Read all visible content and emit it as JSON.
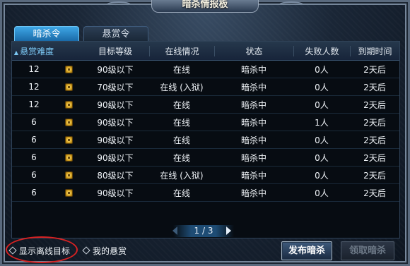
{
  "window": {
    "title": "暗杀情报板"
  },
  "tabs": [
    {
      "label": "暗杀令",
      "active": true
    },
    {
      "label": "悬赏令",
      "active": false
    }
  ],
  "table": {
    "headers": [
      "悬赏难度",
      "目标等级",
      "在线情况",
      "状态",
      "失败人数",
      "到期时间"
    ],
    "sorted_column": "悬赏难度",
    "rows": [
      {
        "difficulty": "12",
        "level": "90级以下",
        "online": "在线",
        "status": "暗杀中",
        "failures": "0人",
        "expire": "2天后"
      },
      {
        "difficulty": "12",
        "level": "70级以下",
        "online": "在线 (入狱)",
        "status": "暗杀中",
        "failures": "0人",
        "expire": "2天后"
      },
      {
        "difficulty": "12",
        "level": "90级以下",
        "online": "在线",
        "status": "暗杀中",
        "failures": "0人",
        "expire": "2天后"
      },
      {
        "difficulty": "6",
        "level": "90级以下",
        "online": "在线",
        "status": "暗杀中",
        "failures": "1人",
        "expire": "2天后"
      },
      {
        "difficulty": "6",
        "level": "90级以下",
        "online": "在线",
        "status": "暗杀中",
        "failures": "0人",
        "expire": "2天后"
      },
      {
        "difficulty": "6",
        "level": "90级以下",
        "online": "在线",
        "status": "暗杀中",
        "failures": "0人",
        "expire": "2天后"
      },
      {
        "difficulty": "6",
        "level": "80级以下",
        "online": "在线 (入狱)",
        "status": "暗杀中",
        "failures": "0人",
        "expire": "2天后"
      },
      {
        "difficulty": "6",
        "level": "90级以下",
        "online": "在线",
        "status": "暗杀中",
        "failures": "0人",
        "expire": "2天后"
      }
    ]
  },
  "pager": {
    "label": "1 / 3"
  },
  "options": {
    "show_offline": "显示离线目标",
    "my_bounty": "我的悬赏"
  },
  "buttons": {
    "publish": "发布暗杀",
    "claim": "领取暗杀"
  },
  "colors": {
    "tab_active": "#2a8ed0",
    "highlight_ring": "#d82222",
    "sorted_header": "#7cc8f4"
  }
}
